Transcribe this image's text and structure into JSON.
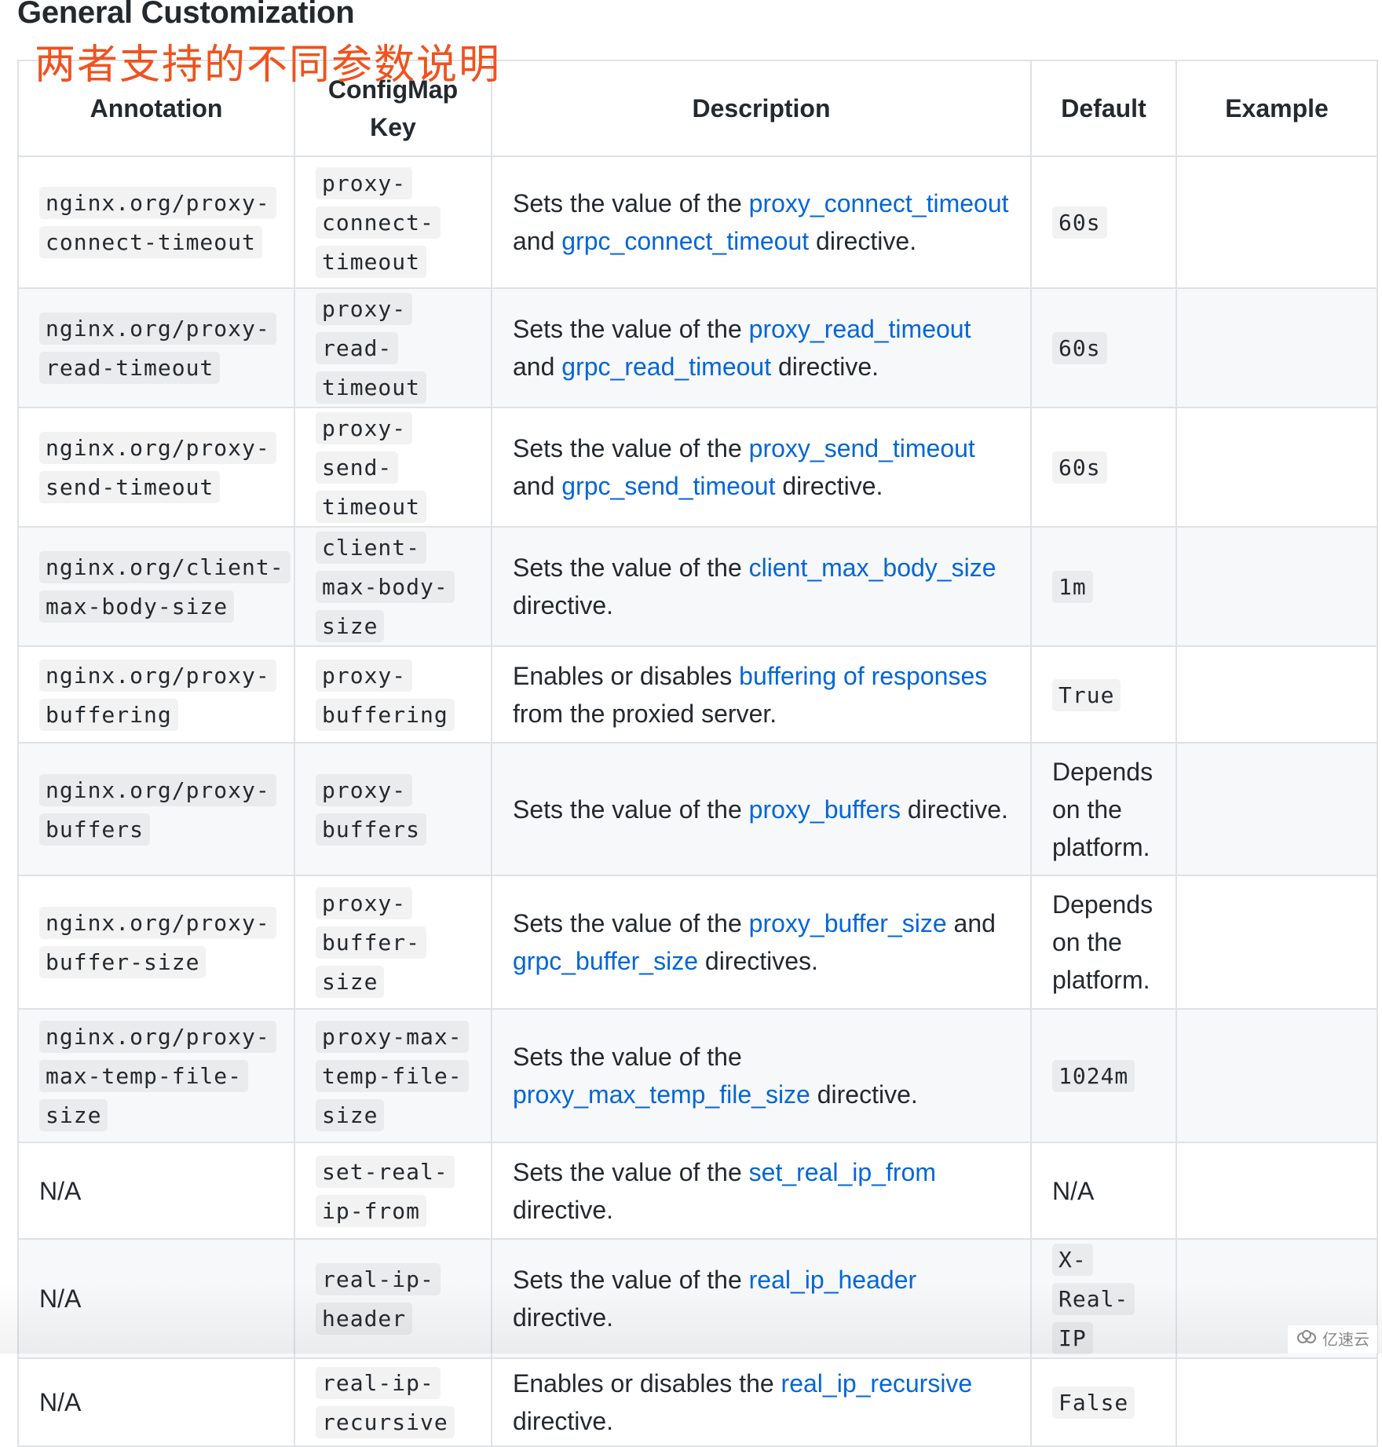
{
  "page": {
    "title": "General Customization",
    "annotation_overlay": "两者支持的不同参数说明",
    "watermark": "亿速云"
  },
  "table": {
    "headers": {
      "annotation": "Annotation",
      "configmap_key_line1": "ConfigMap",
      "configmap_key_line2": "Key",
      "description": "Description",
      "default": "Default",
      "example": "Example"
    },
    "rows": [
      {
        "annotation": "nginx.org/proxy-connect-timeout",
        "key": "proxy-connect-timeout",
        "desc": [
          {
            "t": "Sets the value of the "
          },
          {
            "link": "proxy_connect_timeout"
          },
          {
            "t": " and "
          },
          {
            "link": "grpc_connect_timeout"
          },
          {
            "t": " directive."
          }
        ],
        "default": "60s",
        "default_code": true,
        "example": ""
      },
      {
        "annotation": "nginx.org/proxy-read-timeout",
        "key": "proxy-read-timeout",
        "desc": [
          {
            "t": "Sets the value of the "
          },
          {
            "link": "proxy_read_timeout"
          },
          {
            "t": " and "
          },
          {
            "link": "grpc_read_timeout"
          },
          {
            "t": " directive."
          }
        ],
        "default": "60s",
        "default_code": true,
        "example": ""
      },
      {
        "annotation": "nginx.org/proxy-send-timeout",
        "key": "proxy-send-timeout",
        "desc": [
          {
            "t": "Sets the value of the "
          },
          {
            "link": "proxy_send_timeout"
          },
          {
            "t": " and "
          },
          {
            "link": "grpc_send_timeout"
          },
          {
            "t": " directive."
          }
        ],
        "default": "60s",
        "default_code": true,
        "example": ""
      },
      {
        "annotation": "nginx.org/client-max-body-size",
        "key": "client-max-body-size",
        "desc": [
          {
            "t": "Sets the value of the "
          },
          {
            "link": "client_max_body_size"
          },
          {
            "t": " directive."
          }
        ],
        "default": "1m",
        "default_code": true,
        "example": ""
      },
      {
        "annotation": "nginx.org/proxy-buffering",
        "key": "proxy-buffering",
        "desc": [
          {
            "t": "Enables or disables "
          },
          {
            "link": "buffering of responses"
          },
          {
            "t": " from the proxied server."
          }
        ],
        "default": "True",
        "default_code": true,
        "example": ""
      },
      {
        "annotation": "nginx.org/proxy-buffers",
        "key": "proxy-buffers",
        "desc": [
          {
            "t": "Sets the value of the "
          },
          {
            "link": "proxy_buffers"
          },
          {
            "t": " directive."
          }
        ],
        "default": "Depends on the platform.",
        "default_code": false,
        "example": ""
      },
      {
        "annotation": "nginx.org/proxy-buffer-size",
        "key": "proxy-buffer-size",
        "desc": [
          {
            "t": "Sets the value of the "
          },
          {
            "link": "proxy_buffer_size"
          },
          {
            "t": " and "
          },
          {
            "link": "grpc_buffer_size"
          },
          {
            "t": " directives."
          }
        ],
        "default": "Depends on the platform.",
        "default_code": false,
        "example": ""
      },
      {
        "annotation": "nginx.org/proxy-max-temp-file-size",
        "key": "proxy-max-temp-file-size",
        "desc": [
          {
            "t": "Sets the value of the "
          },
          {
            "link": "proxy_max_temp_file_size"
          },
          {
            "t": " directive."
          }
        ],
        "default": "1024m",
        "default_code": true,
        "example": ""
      },
      {
        "annotation": "N/A",
        "annotation_code": false,
        "key": "set-real-ip-from",
        "desc": [
          {
            "t": "Sets the value of the "
          },
          {
            "link": "set_real_ip_from"
          },
          {
            "t": " directive."
          }
        ],
        "default": "N/A",
        "default_code": false,
        "example": ""
      },
      {
        "annotation": "N/A",
        "annotation_code": false,
        "key": "real-ip-header",
        "desc": [
          {
            "t": "Sets the value of the "
          },
          {
            "link": "real_ip_header"
          },
          {
            "t": " directive."
          }
        ],
        "default": "X-Real-IP",
        "default_code": true,
        "example": ""
      },
      {
        "annotation": "N/A",
        "annotation_code": false,
        "key": "real-ip-recursive",
        "desc": [
          {
            "t": "Enables or disables the "
          },
          {
            "link": "real_ip_recursive"
          },
          {
            "t": " directive."
          }
        ],
        "default": "False",
        "default_code": true,
        "example": ""
      }
    ]
  },
  "colors": {
    "link": "#0366d6",
    "annotation_overlay": "#f0521e",
    "text": "#24292e",
    "stripe": "#f6f8fa",
    "border": "#dfe2e5"
  }
}
